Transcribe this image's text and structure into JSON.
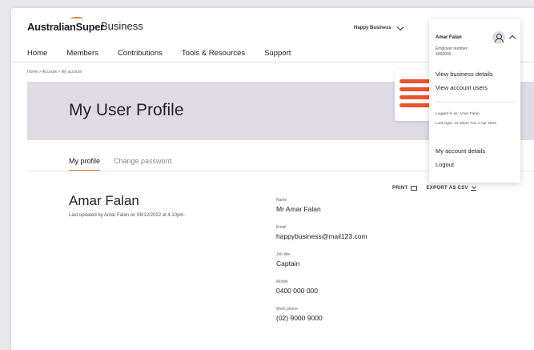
{
  "header": {
    "logo_text": "AustralianSuper",
    "logo_sub": "Business",
    "business_name": "Happy Business"
  },
  "nav": {
    "items": [
      "Home",
      "Members",
      "Contributions",
      "Tools & Resources",
      "Support"
    ]
  },
  "breadcrumb": "Home >  Account >  My account",
  "page_title": "My User Profile",
  "tabs": [
    "My profile",
    "Change password"
  ],
  "profile": {
    "name": "Amar Falan",
    "updated": "Last updated by Amar Falan on 08/12/2022 at 4.10pm.",
    "print_label": "PRINT",
    "export_label": "EXPORT AS CSV",
    "fields": [
      {
        "label": "Name",
        "value": "Mr Amar Falan"
      },
      {
        "label": "Email",
        "value": "happybusiness@mail123.com"
      },
      {
        "label": "Job title",
        "value": "Captain"
      },
      {
        "label": "Mobile",
        "value": "0400 000 000"
      },
      {
        "label": "Work phone",
        "value": "(02) 9000 9000"
      }
    ]
  },
  "dropdown": {
    "user": "Amar Falan",
    "employer_label": "Employer number:",
    "employer_number": "4000000",
    "links1": [
      "View business details",
      "View account users"
    ],
    "logged_in": "Logged in as: Amar Falan",
    "last_login": "Last login: 12:10pm Tue 4 Apr 2023",
    "links2": [
      "My account details",
      "Logout"
    ]
  },
  "colors": {
    "accent": "#f37021",
    "banner": "#dedbe5",
    "stripes": "#e8542b"
  }
}
